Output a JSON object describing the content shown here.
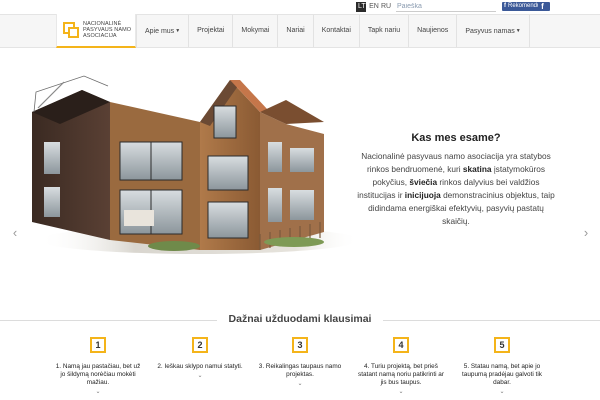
{
  "languages": [
    {
      "label": "LT",
      "active": true
    },
    {
      "label": "EN",
      "active": false
    },
    {
      "label": "RU",
      "active": false
    }
  ],
  "search": {
    "placeholder": "Paieška"
  },
  "facebook": {
    "button_label": "Rekomenduoti",
    "icon_glyph": "f"
  },
  "logo": {
    "lines": [
      "Nacionalinė",
      "pasyvaus namo",
      "asociacija"
    ]
  },
  "nav": {
    "items": [
      {
        "label": "Apie mus",
        "dropdown": true
      },
      {
        "label": "Projektai",
        "dropdown": false
      },
      {
        "label": "Mokymai",
        "dropdown": false
      },
      {
        "label": "Nariai",
        "dropdown": false
      },
      {
        "label": "Kontaktai",
        "dropdown": false
      },
      {
        "label": "Tapk nariu",
        "dropdown": false
      },
      {
        "label": "Naujienos",
        "dropdown": false
      },
      {
        "label": "Pasyvus namas",
        "dropdown": true
      }
    ]
  },
  "hero": {
    "title": "Kas mes esame?",
    "text_parts": [
      {
        "t": "Nacionalinė pasyvaus namo asociacija yra statybos rinkos bendruomenė, kuri ",
        "bold": false
      },
      {
        "t": "skatina",
        "bold": true
      },
      {
        "t": " įstatymokūros pokyčius, ",
        "bold": false
      },
      {
        "t": "šviečia",
        "bold": true
      },
      {
        "t": " rinkos dalyvius bei valdžios institucijas ir ",
        "bold": false
      },
      {
        "t": "inicijuoja",
        "bold": true
      },
      {
        "t": " demonstracinius objektus, taip didindama energiškai efektyvių, pasyvių pastatų skaičių.",
        "bold": false
      }
    ]
  },
  "faq": {
    "title": "Dažnai užduodami klausimai",
    "steps": [
      {
        "number": "1",
        "text": "1. Namą jau pastačiau, bet už jo šildymą norėčiau mokėti mažiau."
      },
      {
        "number": "2",
        "text": "2. Ieškau sklypo namui statyti."
      },
      {
        "number": "3",
        "text": "3. Reikalingas taupaus namo projektas."
      },
      {
        "number": "4",
        "text": "4. Turiu projektą, bet prieš statant namą noriu patikrinti ar jis bus taupus."
      },
      {
        "number": "5",
        "text": "5. Statau namą, bet apie jo taupumą pradėjau galvoti tik dabar."
      }
    ]
  },
  "colors": {
    "accent": "#f4b41a",
    "facebook": "#3b5998",
    "nav_bg": "#f6f6f6"
  }
}
